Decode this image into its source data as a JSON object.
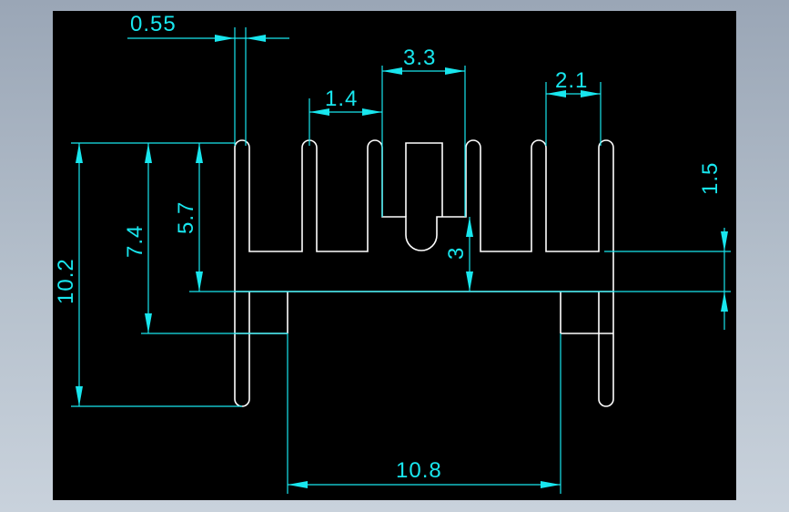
{
  "colors": {
    "background": "#000000",
    "outline": "#ffffff",
    "dimension": "#18e6ee"
  },
  "dimensions": {
    "d055": "0.55",
    "d33": "3.3",
    "d14": "1.4",
    "d21": "2.1",
    "d15": "1.5",
    "d102": "10.2",
    "d74": "7.4",
    "d57": "5.7",
    "d3": "3",
    "d108": "10.8"
  }
}
